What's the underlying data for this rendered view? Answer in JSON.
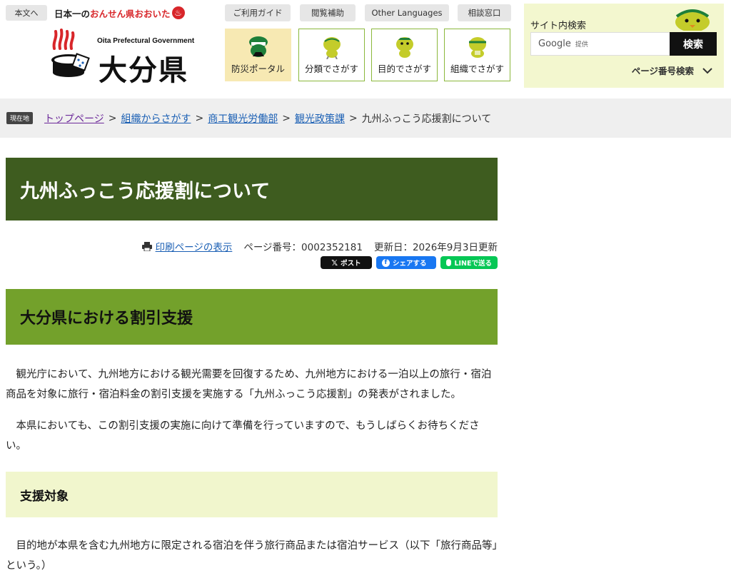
{
  "header": {
    "skip_label": "本文へ",
    "onsen_prefix": "日本一の",
    "onsen_highlight": "おんせん県おおいた",
    "logo_en": "Oita Prefectural Government",
    "logo_ja": "大分県",
    "utility_links": [
      "ご利用ガイド",
      "閲覧補助",
      "Other Languages",
      "相談窓口"
    ],
    "nav_tiles": [
      "防災ポータル",
      "分類でさがす",
      "目的でさがす",
      "組織でさがす"
    ],
    "accent_color": "#8bb83c"
  },
  "search": {
    "title": "サイト内検索",
    "engine": "Google",
    "provided": "提供",
    "button": "検索",
    "page_number_search": "ページ番号検索"
  },
  "breadcrumb": {
    "label": "現在地",
    "items": [
      "トップページ",
      "組織からさがす",
      "商工観光労働部",
      "観光政策課"
    ],
    "separator": ">",
    "current": "九州ふっこう応援割について"
  },
  "main": {
    "title": "九州ふっこう応援割について",
    "print_label": "印刷ページの表示",
    "page_number": "ページ番号：0002352181",
    "updated": "更新日：2026年9月3日更新",
    "share": {
      "x": "ポスト",
      "facebook": "シェアする",
      "line": "LINEで送る"
    },
    "section_heading": "大分県における割引支援",
    "paragraph1": "観光庁において、九州地方における観光需要を回復するため、九州地方における一泊以上の旅行・宿泊商品を対象に旅行・宿泊料金の割引支援を実施する「九州ふっこう応援割」の発表がされました。",
    "paragraph2": "本県においても、この割引支援の実施に向けて準備を行っていますので、もうしばらくお待ちください。",
    "subheading": "支援対象",
    "paragraph3": "目的地が本県を含む九州地方に限定される宿泊を伴う旅行商品または宿泊サービス（以下「旅行商品等」という。）",
    "title_bg": "#3e5c1f",
    "section_bg": "#73a12b",
    "sub_bg": "#f1f6cd"
  }
}
